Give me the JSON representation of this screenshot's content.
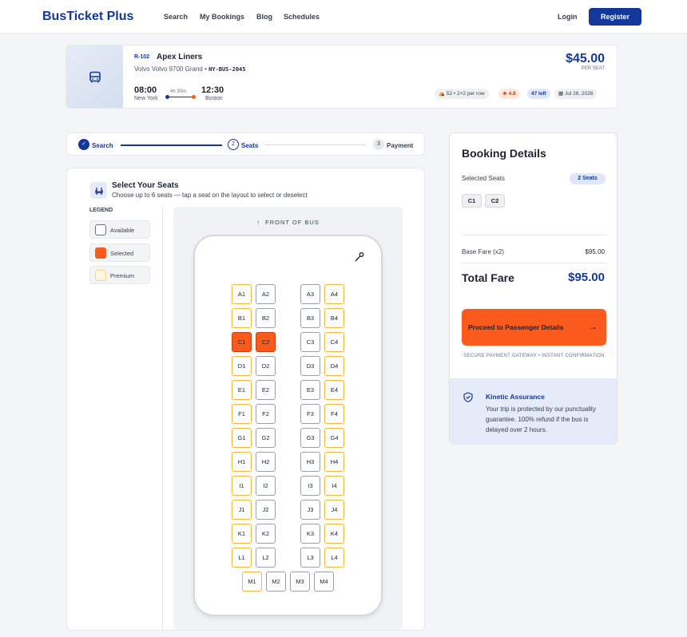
{
  "nav": {
    "brand": "BusTicket Plus",
    "links": [
      "Search",
      "My Bookings",
      "Blog",
      "Schedules"
    ],
    "login": "Login",
    "register": "Register"
  },
  "trip": {
    "route_code": "R-102",
    "operator": "Apex Liners",
    "vehicle": "Volvo Volvo 9700 Grand •",
    "vehicle_code": "NY-BUS-2045",
    "depart_time": "08:00",
    "depart_city": "New York",
    "duration": "4h 30m",
    "arrive_time": "12:30",
    "arrive_city": "Boston",
    "price": "$45.00",
    "price_unit": "PER SEAT",
    "chips": {
      "capacity": "52 • 2×2 per row",
      "rating": "4.8",
      "left": "47 left",
      "date": "Jul 28, 2026"
    }
  },
  "stepper": {
    "steps": [
      {
        "label": "Search",
        "num": "✓"
      },
      {
        "label": "Seats",
        "num": "2"
      },
      {
        "label": "Payment",
        "num": "3"
      }
    ]
  },
  "seat_panel": {
    "title": "Select Your Seats",
    "subtitle": "Choose up to 6 seats — tap a seat on the layout to select or deselect",
    "legend_header": "LEGEND",
    "legend": [
      "Available",
      "Selected",
      "Premium"
    ],
    "front_label": "FRONT OF BUS",
    "selected_seats": [
      "C1",
      "C2"
    ]
  },
  "booking": {
    "title": "Booking Details",
    "selected_label": "Selected Seats",
    "seat_count": "2 Seats",
    "seats": [
      "C1",
      "C2"
    ],
    "base_label": "Base Fare (x2)",
    "base_value": "$95.00",
    "total_label": "Total Fare",
    "total_value": "$95.00",
    "proceed": "Proceed to Passenger Details",
    "secure": "SECURE PAYMENT GATEWAY • INSTANT CONFIRMATION",
    "assurance_title": "Kinetic Assurance",
    "assurance_text": "Your trip is protected by our punctuality guarantee. 100% refund if the bus is delayed over 2 hours."
  },
  "colors": {
    "primary": "#14389a",
    "accent": "#fa5a1b",
    "premium": "#f4b73a"
  }
}
